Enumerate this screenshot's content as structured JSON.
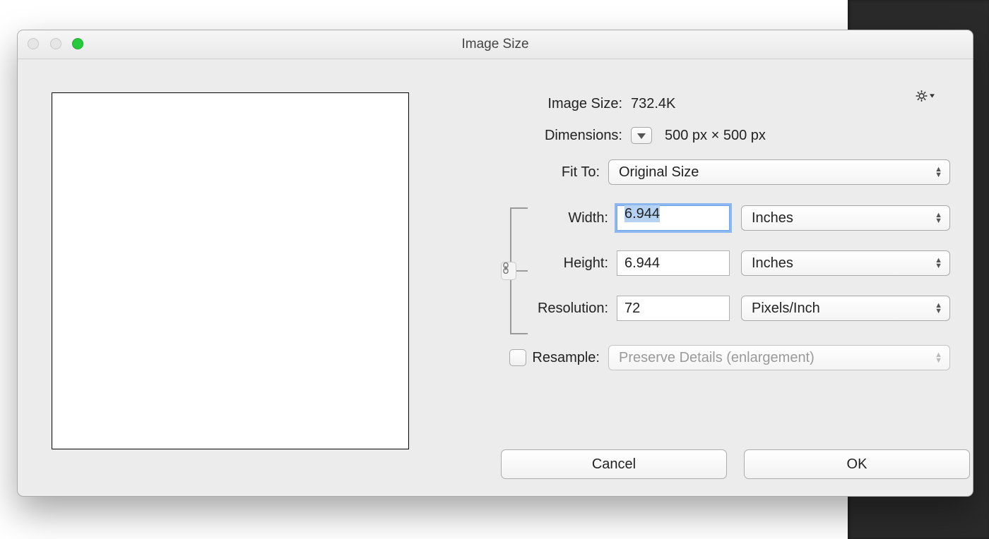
{
  "window": {
    "title": "Image Size"
  },
  "info": {
    "image_size_label": "Image Size:",
    "image_size_value": "732.4K",
    "dimensions_label": "Dimensions:",
    "dimensions_value": "500 px  ×  500 px"
  },
  "fit_to": {
    "label": "Fit To:",
    "value": "Original Size"
  },
  "width": {
    "label": "Width:",
    "value": "6.944",
    "unit": "Inches"
  },
  "height": {
    "label": "Height:",
    "value": "6.944",
    "unit": "Inches"
  },
  "resolution": {
    "label": "Resolution:",
    "value": "72",
    "unit": "Pixels/Inch"
  },
  "resample": {
    "label": "Resample:",
    "value": "Preserve Details (enlargement)",
    "checked": false
  },
  "buttons": {
    "cancel": "Cancel",
    "ok": "OK"
  }
}
